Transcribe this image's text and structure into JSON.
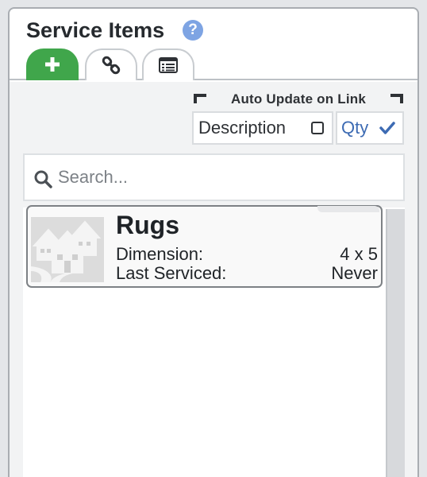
{
  "header": {
    "title": "Service Items",
    "help_icon": "question-circle-icon",
    "tabs": [
      {
        "icon": "plus-icon",
        "active": true
      },
      {
        "icon": "link-icon",
        "active": false
      },
      {
        "icon": "list-icon",
        "active": false
      }
    ]
  },
  "auto_update": {
    "label": "Auto Update on Link",
    "options": [
      {
        "label": "Description",
        "checked": false
      },
      {
        "label": "Qty",
        "checked": true
      }
    ]
  },
  "search": {
    "placeholder": "Search..."
  },
  "items": [
    {
      "name": "Rugs",
      "image_icon": "house-icon",
      "fields": [
        {
          "label": "Dimension:",
          "value": "4 x 5"
        },
        {
          "label": "Last Serviced:",
          "value": "Never"
        }
      ]
    }
  ],
  "colors": {
    "accent_green": "#40a64b",
    "link_blue": "#3d6bb3",
    "help_blue": "#7ea4e3"
  }
}
